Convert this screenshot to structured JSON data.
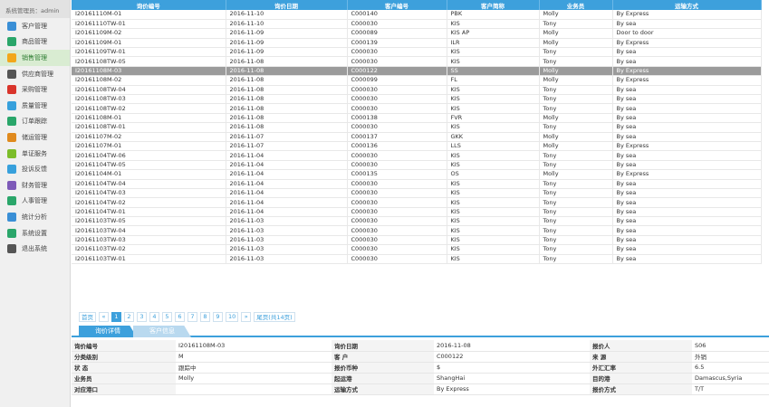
{
  "sidebar": {
    "system_user": "系统管理员：admin",
    "items": [
      {
        "label": "客户管理",
        "icon": "users-icon",
        "color": "#3a8fd6"
      },
      {
        "label": "商品管理",
        "icon": "grid-icon",
        "color": "#2aa66a"
      },
      {
        "label": "销售管理",
        "icon": "chart-icon",
        "color": "#f2a71b",
        "active": true
      },
      {
        "label": "供应商管理",
        "icon": "database-icon",
        "color": "#555555"
      },
      {
        "label": "采购管理",
        "icon": "cart-icon",
        "color": "#d9342b"
      },
      {
        "label": "质量管理",
        "icon": "gem-icon",
        "color": "#37a0dc"
      },
      {
        "label": "订单跟踪",
        "icon": "checklist-icon",
        "color": "#2aa66a"
      },
      {
        "label": "储运管理",
        "icon": "boxes-icon",
        "color": "#e08a1e"
      },
      {
        "label": "单证服务",
        "icon": "leaf-icon",
        "color": "#7cbd2a"
      },
      {
        "label": "投诉反馈",
        "icon": "monitor-icon",
        "color": "#37a0dc"
      },
      {
        "label": "财务管理",
        "icon": "book-icon",
        "color": "#7d5ab8"
      },
      {
        "label": "人事管理",
        "icon": "person-doc-icon",
        "color": "#2aa66a"
      },
      {
        "label": "统计分析",
        "icon": "bar-chart-icon",
        "color": "#3a8fd6"
      },
      {
        "label": "系统设置",
        "icon": "gear-icon",
        "color": "#2aa66a"
      },
      {
        "label": "退出系统",
        "icon": "power-icon",
        "color": "#555555"
      }
    ]
  },
  "grid": {
    "columns": [
      "询价编号",
      "询价日期",
      "客户编号",
      "客户简称",
      "业务员",
      "运输方式"
    ],
    "rows": [
      [
        "I20161110M-01",
        "2016-11-10",
        "C000140",
        "PBK",
        "Molly",
        "By Express"
      ],
      [
        "I20161110TW-01",
        "2016-11-10",
        "C000030",
        "KIS",
        "Tony",
        "By sea"
      ],
      [
        "I20161109M-02",
        "2016-11-09",
        "C000089",
        "KIS AP",
        "Molly",
        "Door to door"
      ],
      [
        "I20161109M-01",
        "2016-11-09",
        "C000139",
        "ILR",
        "Molly",
        "By Express"
      ],
      [
        "I20161109TW-01",
        "2016-11-09",
        "C000030",
        "KIS",
        "Tony",
        "By sea"
      ],
      [
        "I20161108TW-05",
        "2016-11-08",
        "C000030",
        "KIS",
        "Tony",
        "By sea"
      ],
      [
        "I20161108M-03",
        "2016-11-08",
        "C000122",
        "SS",
        "Molly",
        "By Express"
      ],
      [
        "I20161108M-02",
        "2016-11-08",
        "C000099",
        "FL",
        "Molly",
        "By Express"
      ],
      [
        "I20161108TW-04",
        "2016-11-08",
        "C000030",
        "KIS",
        "Tony",
        "By sea"
      ],
      [
        "I20161108TW-03",
        "2016-11-08",
        "C000030",
        "KIS",
        "Tony",
        "By sea"
      ],
      [
        "I20161108TW-02",
        "2016-11-08",
        "C000030",
        "KIS",
        "Tony",
        "By sea"
      ],
      [
        "I20161108M-01",
        "2016-11-08",
        "C000138",
        "FVR",
        "Molly",
        "By sea"
      ],
      [
        "I20161108TW-01",
        "2016-11-08",
        "C000030",
        "KIS",
        "Tony",
        "By sea"
      ],
      [
        "I20161107M-02",
        "2016-11-07",
        "C000137",
        "GKK",
        "Molly",
        "By sea"
      ],
      [
        "I20161107M-01",
        "2016-11-07",
        "C000136",
        "LLS",
        "Molly",
        "By Express"
      ],
      [
        "I20161104TW-06",
        "2016-11-04",
        "C000030",
        "KIS",
        "Tony",
        "By sea"
      ],
      [
        "I20161104TW-05",
        "2016-11-04",
        "C000030",
        "KIS",
        "Tony",
        "By sea"
      ],
      [
        "I20161104M-01",
        "2016-11-04",
        "C000135",
        "OS",
        "Molly",
        "By Express"
      ],
      [
        "I20161104TW-04",
        "2016-11-04",
        "C000030",
        "KIS",
        "Tony",
        "By sea"
      ],
      [
        "I20161104TW-03",
        "2016-11-04",
        "C000030",
        "KIS",
        "Tony",
        "By sea"
      ],
      [
        "I20161104TW-02",
        "2016-11-04",
        "C000030",
        "KIS",
        "Tony",
        "By sea"
      ],
      [
        "I20161104TW-01",
        "2016-11-04",
        "C000030",
        "KIS",
        "Tony",
        "By sea"
      ],
      [
        "I20161103TW-05",
        "2016-11-03",
        "C000030",
        "KIS",
        "Tony",
        "By sea"
      ],
      [
        "I20161103TW-04",
        "2016-11-03",
        "C000030",
        "KIS",
        "Tony",
        "By sea"
      ],
      [
        "I20161103TW-03",
        "2016-11-03",
        "C000030",
        "KIS",
        "Tony",
        "By sea"
      ],
      [
        "I20161103TW-02",
        "2016-11-03",
        "C000030",
        "KIS",
        "Tony",
        "By sea"
      ],
      [
        "I20161103TW-01",
        "2016-11-03",
        "C000030",
        "KIS",
        "Tony",
        "By sea"
      ]
    ],
    "selected_index": 6
  },
  "pager": {
    "first": "首页",
    "prev": "«",
    "pages": [
      "1",
      "2",
      "3",
      "4",
      "5",
      "6",
      "7",
      "8",
      "9",
      "10"
    ],
    "current": "1",
    "next": "»",
    "last": "尾页(共14页)"
  },
  "tabs": [
    {
      "label": "询价详情",
      "active": true
    },
    {
      "label": "客户信息",
      "active": false
    }
  ],
  "detail": [
    [
      "询价编号",
      "I20161108M-03",
      "询价日期",
      "2016-11-08",
      "报价人",
      "S06"
    ],
    [
      "分类级别",
      "M",
      "客 户",
      "C000122",
      "来 源",
      "外销"
    ],
    [
      "状 态",
      "跟踪中",
      "报价币种",
      "$",
      "外汇汇率",
      "6.5"
    ],
    [
      "业务员",
      "Molly",
      "起运港",
      "ShangHai",
      "目的港",
      "Damascus,Syria"
    ],
    [
      "对应港口",
      "",
      "运输方式",
      "By Express",
      "报价方式",
      "T/T"
    ]
  ],
  "colors": {
    "accent": "#3da0dc",
    "selected_row": "#9b9b9b",
    "active_nav": "#d9ecd2",
    "tab_inactive": "#b9d9ef"
  }
}
